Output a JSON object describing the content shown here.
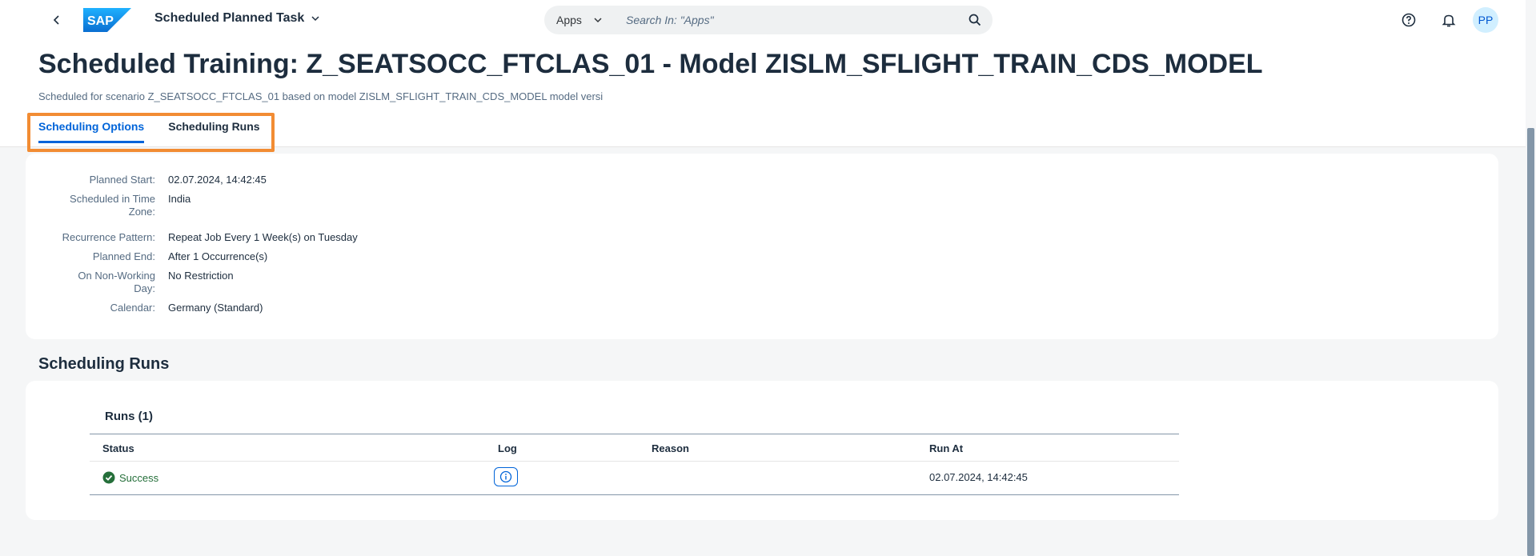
{
  "shell": {
    "app_title": "Scheduled Planned Task",
    "search_scope": "Apps",
    "search_placeholder": "Search In: \"Apps\"",
    "avatar_initials": "PP",
    "logo_text": "SAP"
  },
  "header": {
    "title": "Scheduled Training: Z_SEATSOCC_FTCLAS_01 - Model ZISLM_SFLIGHT_TRAIN_CDS_MODEL",
    "subtitle": "Scheduled for scenario Z_SEATSOCC_FTCLAS_01 based on model ZISLM_SFLIGHT_TRAIN_CDS_MODEL model versi",
    "tabs": [
      {
        "label": "Scheduling Options",
        "active": true
      },
      {
        "label": "Scheduling Runs",
        "active": false
      }
    ]
  },
  "options": {
    "fields": [
      {
        "label": "Planned Start:",
        "value": "02.07.2024, 14:42:45"
      },
      {
        "label": "Scheduled in Time Zone:",
        "value": "India"
      },
      {
        "label": "Recurrence Pattern:",
        "value": "Repeat Job Every 1 Week(s) on Tuesday"
      },
      {
        "label": "Planned End:",
        "value": "After 1 Occurrence(s)"
      },
      {
        "label": "On Non-Working Day:",
        "value": "No Restriction"
      },
      {
        "label": "Calendar:",
        "value": "Germany (Standard)"
      }
    ]
  },
  "runs_section": {
    "title": "Scheduling Runs",
    "table_title": "Runs (1)",
    "columns": [
      "Status",
      "Log",
      "Reason",
      "Run At"
    ],
    "rows": [
      {
        "status": "Success",
        "reason": "",
        "run_at": "02.07.2024, 14:42:45"
      }
    ]
  },
  "colors": {
    "accent": "#0064d9",
    "success": "#256f3a",
    "highlight": "#f28c33"
  }
}
